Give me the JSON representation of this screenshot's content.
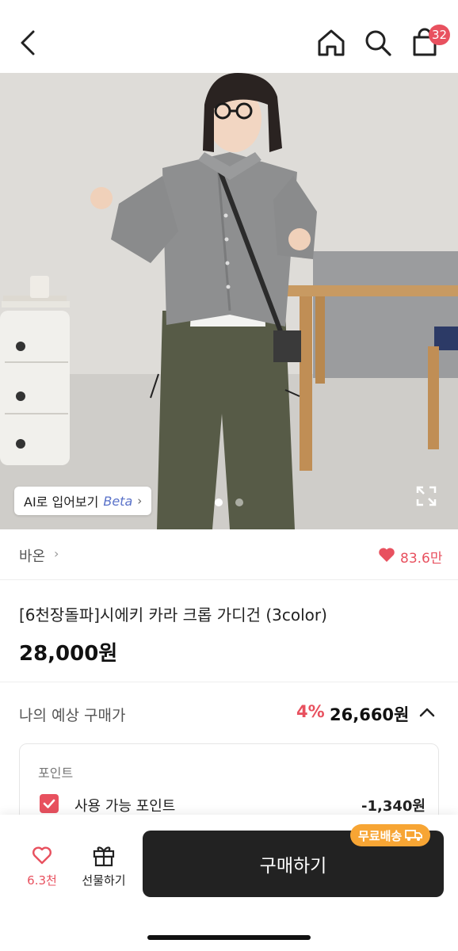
{
  "header": {
    "cart_count": "32"
  },
  "photo": {
    "ai_tryon_label": "AI로 입어보기",
    "ai_tryon_beta": "Beta",
    "ai_tryon_chevron": "›",
    "page_count": 2,
    "active_page": 1
  },
  "brand": {
    "name": "바온",
    "chevron": "›",
    "likes": "83.6만"
  },
  "product": {
    "title": "[6천장돌파]시에키 카라 크롭 가디건 (3color)",
    "price": "28,000원"
  },
  "expected": {
    "label": "나의 예상 구매가",
    "discount": "4%",
    "price": "26,660원"
  },
  "points": {
    "title": "포인트",
    "use_label": "사용 가능 포인트",
    "amount": "-1,340원",
    "checked": true
  },
  "bottom": {
    "wish_count": "6.3천",
    "gift_label": "선물하기",
    "buy_label": "구매하기",
    "free_shipping": "무료배송"
  },
  "colors": {
    "accent": "#e8515f",
    "buy_button": "#222222",
    "free_shipping_badge": "#f7a534"
  }
}
